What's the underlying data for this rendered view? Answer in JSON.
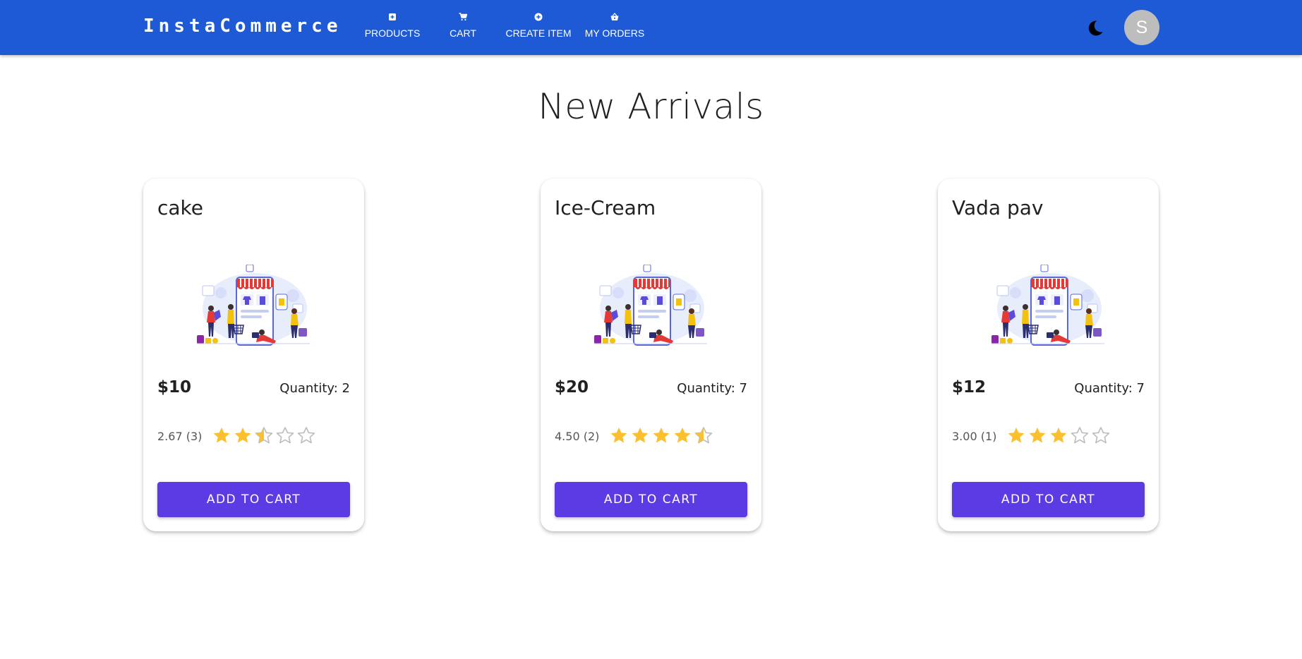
{
  "appbar": {
    "brand": "InstaCommerce",
    "color": "#1f5ad6",
    "nav": [
      {
        "label": "PRODUCTS",
        "icon": "add-box-icon"
      },
      {
        "label": "CART",
        "icon": "shopping-cart-icon"
      },
      {
        "label": "CREATE ITEM",
        "icon": "add-circle-icon"
      },
      {
        "label": "MY ORDERS",
        "icon": "shopping-basket-icon"
      }
    ],
    "theme_icon": "moon-icon",
    "avatar_initial": "S"
  },
  "page": {
    "title": "New Arrivals"
  },
  "products": [
    {
      "name": "cake",
      "price": "$10",
      "quantity": "Quantity: 2",
      "rating_text": "2.67 (3)",
      "rating": 2.67,
      "button": "ADD TO CART",
      "image_icon": "online-store-illustration"
    },
    {
      "name": "Ice-Cream",
      "price": "$20",
      "quantity": "Quantity: 7",
      "rating_text": "4.50 (2)",
      "rating": 4.5,
      "button": "ADD TO CART",
      "image_icon": "online-store-illustration"
    },
    {
      "name": "Vada pav",
      "price": "$12",
      "quantity": "Quantity: 7",
      "rating_text": "3.00 (1)",
      "rating": 3.0,
      "button": "ADD TO CART",
      "image_icon": "online-store-illustration"
    }
  ],
  "colors": {
    "button": "#5c3be4",
    "star_filled": "#fbc02d",
    "star_empty": "#bdbdbd"
  }
}
